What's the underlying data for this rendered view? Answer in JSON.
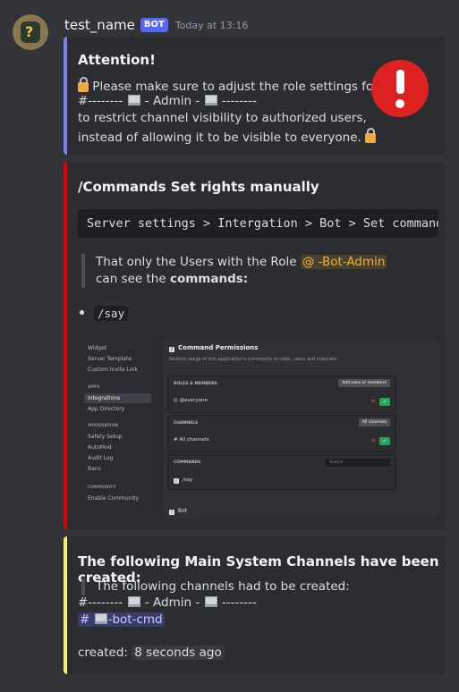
{
  "message": {
    "username": "test_name",
    "badge": "BOT",
    "timestamp": "Today at 13:16"
  },
  "embed1": {
    "color": "#7c7ff2",
    "title": "Attention!",
    "line1": "Please make sure to adjust the role settings for",
    "line2_a": "#--------",
    "line2_b": "- Admin -",
    "line2_c": "--------",
    "line3": "to restrict channel visibility to authorized users,",
    "line4": "instead of allowing it to be visible to everyone."
  },
  "embed2": {
    "color": "#e00000",
    "title": "/Commands Set rights manually",
    "code": "Server settings > Intergation > Bot > Set commands",
    "quote_prefix": "That only the Users with the Role",
    "role_mention": "@ -Bot-Admin",
    "quote_line2_prefix": "can see the",
    "quote_line2_bold": "commands:",
    "list_item": "/say",
    "screenshot": {
      "sidebar": {
        "items_top": [
          "Widget",
          "Server Template",
          "Custom Invite Link"
        ],
        "apps_header": "APPS",
        "apps_items": [
          "Integrations",
          "App Directory"
        ],
        "moderation_header": "MODERATION",
        "moderation_items": [
          "Safety Setup",
          "AutoMod",
          "Audit Log",
          "Bans"
        ],
        "community_header": "COMMUNITY",
        "community_items": [
          "Enable Community"
        ]
      },
      "panel_title": "Command Permissions",
      "panel_subtitle": "Restrict usage of this application's commands to roles, users and channels",
      "roles_header": "ROLES & MEMBERS",
      "add_roles_button": "Add roles or members",
      "everyone_row": "@everyone",
      "channels_header": "CHANNELS",
      "add_channels_button": "All channels",
      "all_channels_row": "All channels",
      "commands_header": "COMMANDS",
      "search_placeholder": "Search",
      "command_row": "/say",
      "bottom_label": "Bot"
    }
  },
  "embed3": {
    "color": "#f5f06a",
    "title": "The following Main System Channels have been created:",
    "quote": "The following channels had to be created:",
    "line_a": "#--------",
    "line_b": "- Admin -",
    "line_c": "--------",
    "channel_mention": "-bot-cmd",
    "created_label": "created:",
    "created_value": "8 seconds ago"
  }
}
